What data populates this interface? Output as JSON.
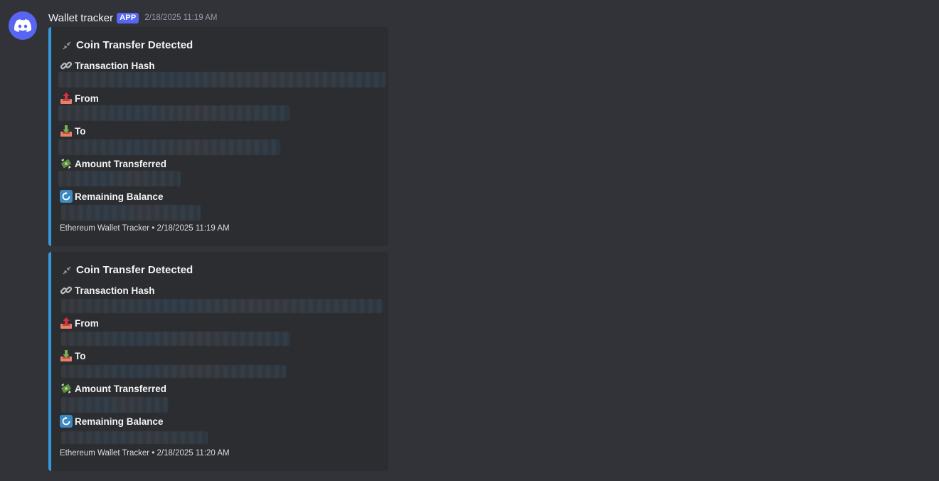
{
  "message": {
    "author": "Wallet tracker",
    "badge": "APP",
    "timestamp": "2/18/2025 11:19 AM"
  },
  "embeds": [
    {
      "title": "Coin Transfer Detected",
      "fields": [
        {
          "name": "Transaction Hash",
          "icon": "link-icon"
        },
        {
          "name": "From",
          "icon": "outbox-tray-icon"
        },
        {
          "name": "To",
          "icon": "inbox-tray-icon"
        },
        {
          "name": "Amount Transferred",
          "icon": "money-with-wings-icon"
        },
        {
          "name": "Remaining Balance",
          "icon": "arrows-counterclockwise-icon"
        }
      ],
      "footer": "Ethereum Wallet Tracker • 2/18/2025 11:19 AM",
      "accent_color": "#3498db"
    },
    {
      "title": "Coin Transfer Detected",
      "fields": [
        {
          "name": "Transaction Hash",
          "icon": "link-icon"
        },
        {
          "name": "From",
          "icon": "outbox-tray-icon"
        },
        {
          "name": "To",
          "icon": "inbox-tray-icon"
        },
        {
          "name": "Amount Transferred",
          "icon": "money-with-wings-icon"
        },
        {
          "name": "Remaining Balance",
          "icon": "arrows-counterclockwise-icon"
        }
      ],
      "footer": "Ethereum Wallet Tracker • 2/18/2025 11:20 AM",
      "accent_color": "#3498db"
    }
  ],
  "colors": {
    "background": "#313338",
    "embed_background": "#2b2d31",
    "brand": "#5865f2"
  }
}
